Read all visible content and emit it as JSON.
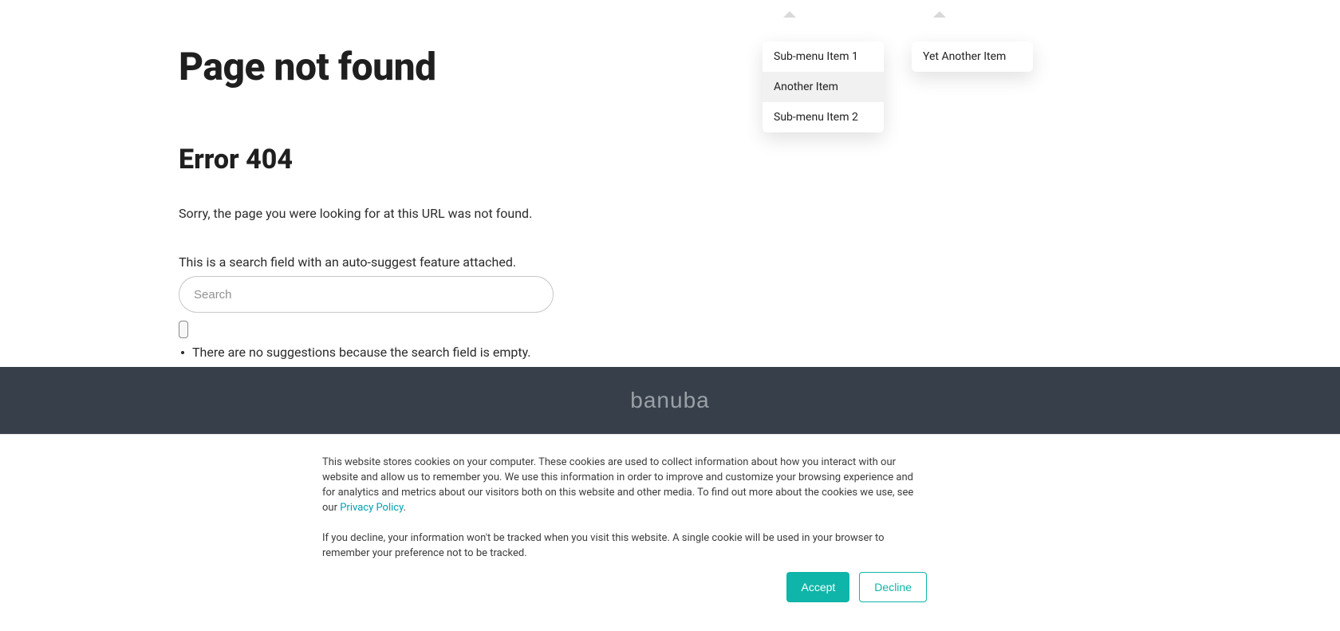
{
  "main": {
    "title": "Page not found",
    "subtitle": "Error 404",
    "message": "Sorry, the page you were looking for at this URL was not found.",
    "search_label": "This is a search field with an auto-suggest feature attached.",
    "search_placeholder": "Search",
    "search_value": "",
    "empty_suggestion": "There are no suggestions because the search field is empty."
  },
  "menus": {
    "menu1": {
      "items": [
        "Sub-menu Item 1",
        "Another Item",
        "Sub-menu Item 2"
      ],
      "highlighted_index": 1
    },
    "menu2": {
      "items": [
        "Yet Another Item"
      ]
    }
  },
  "footer": {
    "logo": "banuba"
  },
  "cookie": {
    "para1_pre": "This website stores cookies on your computer. These cookies are used to collect information about how you interact with our website and allow us to remember you. We use this information in order to improve and customize your browsing experience and for analytics and metrics about our visitors both on this website and other media. To find out more about the cookies we use, see our ",
    "link_text": "Privacy Policy",
    "para1_post": ".",
    "para2": "If you decline, your information won't be tracked when you visit this website. A single cookie will be used in your browser to remember your preference not to be tracked.",
    "accept": "Accept",
    "decline": "Decline"
  }
}
